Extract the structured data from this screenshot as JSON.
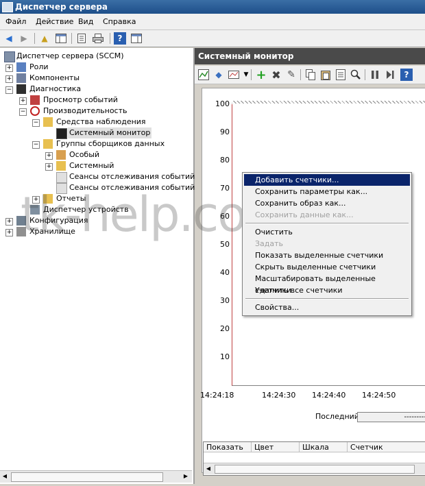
{
  "window": {
    "title": "Диспетчер сервера"
  },
  "menubar": {
    "items": [
      "Файл",
      "Действие",
      "Вид",
      "Справка"
    ]
  },
  "tree": {
    "root": "Диспетчер сервера (SCCM)",
    "items": [
      {
        "label": "Роли"
      },
      {
        "label": "Компоненты"
      },
      {
        "label": "Диагностика"
      },
      {
        "label": "Просмотр событий"
      },
      {
        "label": "Производительность"
      },
      {
        "label": "Средства наблюдения"
      },
      {
        "label": "Системный монитор"
      },
      {
        "label": "Группы сборщиков данных"
      },
      {
        "label": "Особый"
      },
      {
        "label": "Системный"
      },
      {
        "label": "Сеансы отслеживания событий"
      },
      {
        "label": "Сеансы отслеживания событий за"
      },
      {
        "label": "Отчеты"
      },
      {
        "label": "Диспетчер устройств"
      },
      {
        "label": "Конфигурация"
      },
      {
        "label": "Хранилище"
      }
    ]
  },
  "pane": {
    "title": "Системный монитор"
  },
  "chart_data": {
    "type": "line",
    "y_ticks": [
      "100",
      "90",
      "80",
      "70",
      "60",
      "50",
      "40",
      "30",
      "20",
      "10"
    ],
    "x_ticks": [
      "14:24:18",
      "14:24:30",
      "14:24:40",
      "14:24:50"
    ],
    "ylim": [
      0,
      100
    ],
    "series": []
  },
  "status": {
    "last_label": "Последний",
    "last_value": "---------"
  },
  "legend": {
    "columns": [
      "Показать",
      "Цвет",
      "Шкала",
      "Счетчик"
    ]
  },
  "context_menu": {
    "items": [
      "Добавить счетчики...",
      "Сохранить параметры как...",
      "Сохранить образ как...",
      "Сохранить данные как...",
      "Очистить",
      "Задать",
      "Показать выделенные счетчики",
      "Скрыть выделенные счетчики",
      "Масштабировать выделенные счетчики",
      "Удалить все счетчики",
      "Свойства..."
    ]
  },
  "watermark": "tk-help.com"
}
